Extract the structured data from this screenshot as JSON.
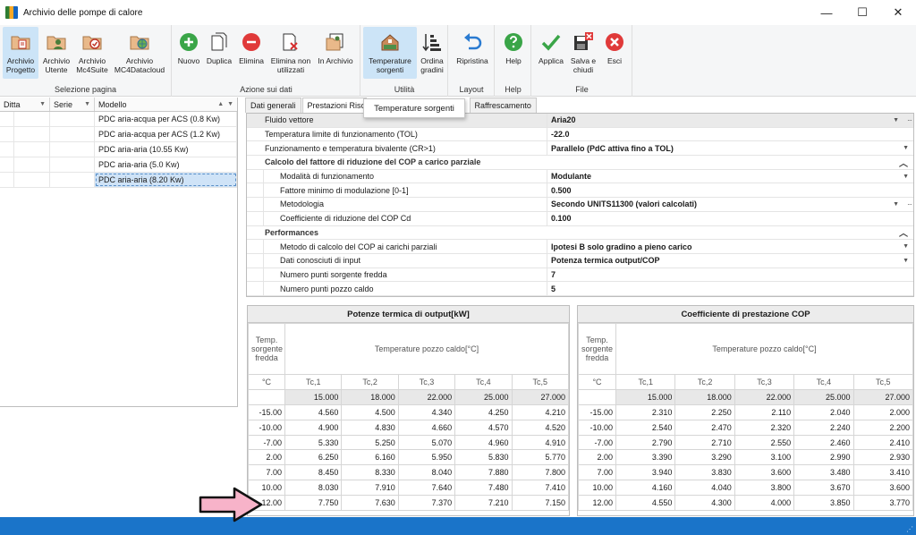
{
  "window": {
    "title": "Archivio delle pompe di calore",
    "minimize": "—",
    "maximize": "☐",
    "close": "✕"
  },
  "ribbon": {
    "groups": [
      {
        "label": "Selezione pagina",
        "buttons": [
          "Archivio Progetto",
          "Archivio Utente",
          "Archivio Mc4Suite",
          "Archivio MC4Datacloud"
        ]
      },
      {
        "label": "Azione sui dati",
        "buttons": [
          "Nuovo",
          "Duplica",
          "Elimina",
          "Elimina non utilizzati",
          "In Archivio"
        ]
      },
      {
        "label": "Utilità",
        "buttons": [
          "Temperature sorgenti",
          "Ordina gradini"
        ]
      },
      {
        "label": "Layout",
        "buttons": [
          "Ripristina"
        ]
      },
      {
        "label": "Help",
        "buttons": [
          "Help"
        ]
      },
      {
        "label": "File",
        "buttons": [
          "Applica",
          "Salva e chiudi",
          "Esci"
        ]
      }
    ],
    "b": {
      "archivio_progetto_1": "Archivio",
      "archivio_progetto_2": "Progetto",
      "archivio_utente_1": "Archivio",
      "archivio_utente_2": "Utente",
      "archivio_mc4suite_1": "Archivio",
      "archivio_mc4suite_2": "Mc4Suite",
      "archivio_mc4datacloud_1": "Archivio",
      "archivio_mc4datacloud_2": "MC4Datacloud",
      "nuovo": "Nuovo",
      "duplica": "Duplica",
      "elimina": "Elimina",
      "elimina_non_1": "Elimina non",
      "elimina_non_2": "utilizzati",
      "in_archivio": "In Archivio",
      "temp_sorg_1": "Temperature",
      "temp_sorg_2": "sorgenti",
      "ordina_1": "Ordina",
      "ordina_2": "gradini",
      "ripristina": "Ripristina",
      "help": "Help",
      "applica": "Applica",
      "salva_1": "Salva e",
      "salva_2": "chiudi",
      "esci": "Esci"
    }
  },
  "tooltip": "Temperature sorgenti",
  "list": {
    "columns": [
      "Ditta",
      "Serie",
      "Modello"
    ],
    "rows": [
      "PDC aria-acqua per ACS (0.8 Kw)",
      "PDC aria-acqua per ACS (1.2 Kw)",
      "PDC aria-aria (10.55 Kw)",
      "PDC aria-aria (5.0 Kw)",
      "PDC aria-aria (8.20 Kw)"
    ],
    "selected_index": 4
  },
  "tabs": [
    "Dati generali",
    "Prestazioni Riscal",
    "Raffrescamento"
  ],
  "props": {
    "fluido": {
      "label": "Fluido vettore",
      "value": "Aria20"
    },
    "tol": {
      "label": "Temperatura limite di funzionamento (TOL)",
      "value": "-22.0"
    },
    "bivalente": {
      "label": "Funzionamento e temperatura bivalente (CR>1)",
      "value": "Parallelo (PdC attiva fino a TOL)"
    },
    "cat_cop": "Calcolo del fattore di riduzione del COP a carico parziale",
    "modalita": {
      "label": "Modalità di funzionamento",
      "value": "Modulante"
    },
    "fattore": {
      "label": "Fattore minimo di modulazione [0-1]",
      "value": "0.500"
    },
    "metodologia": {
      "label": "Metodologia",
      "value": "Secondo UNITS11300 (valori calcolati)"
    },
    "cd": {
      "label": "Coefficiente di riduzione  del COP Cd",
      "value": "0.100"
    },
    "cat_perf": "Performances",
    "metodo": {
      "label": "Metodo di calcolo del COP ai carichi parziali",
      "value": "Ipotesi B solo gradino a pieno carico"
    },
    "dati": {
      "label": "Dati conosciuti di input",
      "value": "Potenza termica output/COP"
    },
    "npfreddo": {
      "label": "Numero punti sorgente fredda",
      "value": "7"
    },
    "npcaldo": {
      "label": "Numero punti pozzo caldo",
      "value": "5"
    }
  },
  "table_common": {
    "row_header_1": "Temp.",
    "row_header_2": "sorgente",
    "row_header_3": "fredda",
    "hot_header": "Temperature pozzo caldo[°C]",
    "unit": "°C",
    "tc_cols": [
      "Tc,1",
      "Tc,2",
      "Tc,3",
      "Tc,4",
      "Tc,5"
    ],
    "tc_values": [
      "15.000",
      "18.000",
      "22.000",
      "25.000",
      "27.000"
    ],
    "cold_temps": [
      "-15.00",
      "-10.00",
      "-7.00",
      "2.00",
      "7.00",
      "10.00",
      "12.00"
    ]
  },
  "table_power": {
    "title": "Potenze termica di output[kW]",
    "rows": [
      [
        "4.560",
        "4.500",
        "4.340",
        "4.250",
        "4.210"
      ],
      [
        "4.900",
        "4.830",
        "4.660",
        "4.570",
        "4.520"
      ],
      [
        "5.330",
        "5.250",
        "5.070",
        "4.960",
        "4.910"
      ],
      [
        "6.250",
        "6.160",
        "5.950",
        "5.830",
        "5.770"
      ],
      [
        "8.450",
        "8.330",
        "8.040",
        "7.880",
        "7.800"
      ],
      [
        "8.030",
        "7.910",
        "7.640",
        "7.480",
        "7.410"
      ],
      [
        "7.750",
        "7.630",
        "7.370",
        "7.210",
        "7.150"
      ]
    ]
  },
  "table_cop": {
    "title": "Coefficiente di prestazione COP",
    "rows": [
      [
        "2.310",
        "2.250",
        "2.110",
        "2.040",
        "2.000"
      ],
      [
        "2.540",
        "2.470",
        "2.320",
        "2.240",
        "2.200"
      ],
      [
        "2.790",
        "2.710",
        "2.550",
        "2.460",
        "2.410"
      ],
      [
        "3.390",
        "3.290",
        "3.100",
        "2.990",
        "2.930"
      ],
      [
        "3.940",
        "3.830",
        "3.600",
        "3.480",
        "3.410"
      ],
      [
        "4.160",
        "4.040",
        "3.800",
        "3.670",
        "3.600"
      ],
      [
        "4.550",
        "4.300",
        "4.000",
        "3.850",
        "3.770"
      ]
    ]
  },
  "colors": {
    "statusbar": "#1a74c9",
    "active_button": "#cce4f7",
    "arrow_fill": "#f7b3c9"
  }
}
